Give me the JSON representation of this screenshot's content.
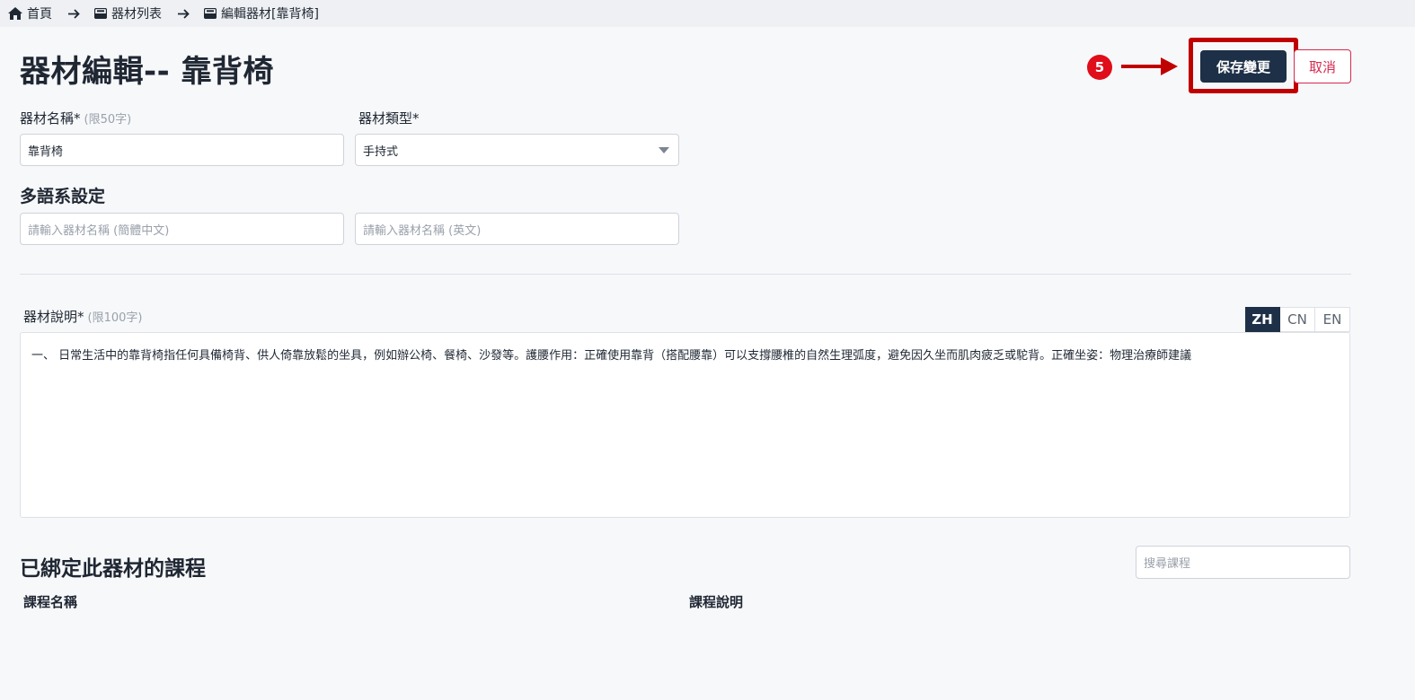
{
  "breadcrumb": {
    "home": "首頁",
    "equipment_list": "器材列表",
    "edit_equipment": "編輯器材[靠背椅]"
  },
  "header": {
    "title": "器材編輯-- 靠背椅",
    "step_number": "5",
    "save_label": "保存變更",
    "cancel_label": "取消"
  },
  "form": {
    "name_label": "器材名稱*",
    "name_hint": "(限50字)",
    "name_value": "靠背椅",
    "type_label": "器材類型*",
    "type_value": "手持式"
  },
  "multilang": {
    "title": "多語系設定",
    "sc_placeholder": "請輸入器材名稱 (簡體中文)",
    "en_placeholder": "請輸入器材名稱 (英文)"
  },
  "description": {
    "label": "器材說明*",
    "hint": "(限100字)",
    "tabs": [
      "ZH",
      "CN",
      "EN"
    ],
    "active_tab": "ZH",
    "text": "一、 日常生活中的靠背椅指任何具備椅背、供人倚靠放鬆的坐具，例如辦公椅、餐椅、沙發等。護腰作用：正確使用靠背（搭配腰靠）可以支撐腰椎的自然生理弧度，避免因久坐而肌肉疲乏或駝背。正確坐姿：物理治療師建議"
  },
  "courses": {
    "title": "已綁定此器材的課程",
    "search_placeholder": "搜尋課程",
    "columns": [
      "課程名稱",
      "課程說明"
    ]
  },
  "colors": {
    "primary": "#1e3047",
    "danger": "#d6294e",
    "highlight": "#c00000",
    "badge": "#e00d1a"
  }
}
